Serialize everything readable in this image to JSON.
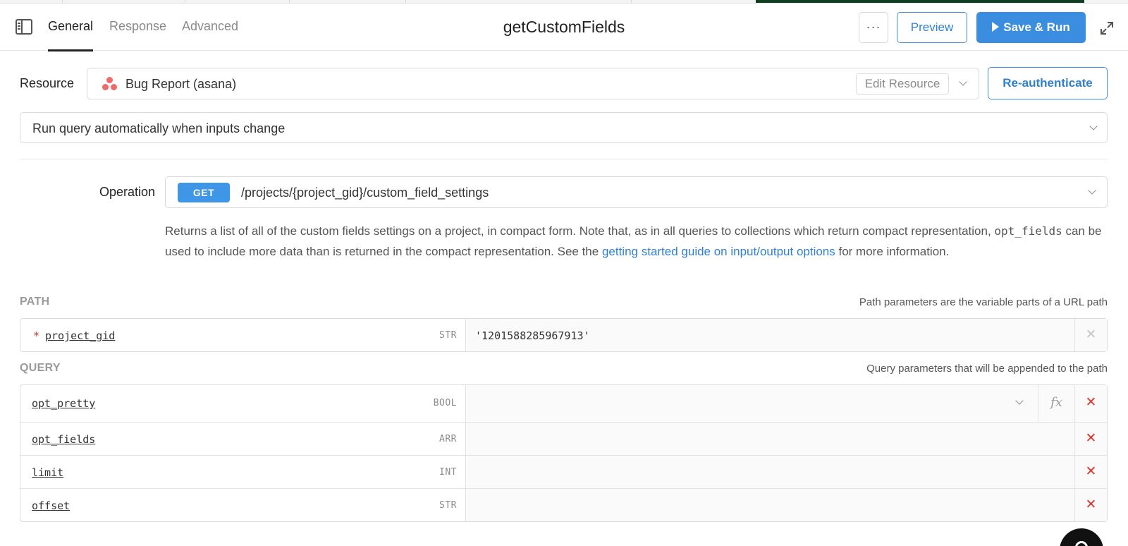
{
  "tabs": [
    {
      "label": "General"
    },
    {
      "label": "Response"
    },
    {
      "label": "Advanced"
    }
  ],
  "query_name": "getCustomFields",
  "header_actions": {
    "more_label": "···",
    "preview_label": "Preview",
    "save_run_label": "Save & Run"
  },
  "resource": {
    "label": "Resource",
    "name": "Bug Report (asana)",
    "edit_label": "Edit Resource",
    "reauth_label": "Re-authenticate"
  },
  "run_mode": {
    "value": "Run query automatically when inputs change"
  },
  "operation": {
    "label": "Operation",
    "method": "GET",
    "path": "/projects/{project_gid}/custom_field_settings",
    "description_part1": "Returns a list of all of the custom fields settings on a project, in compact form. Note that, as in all queries to collections which return compact representation,",
    "description_code": "opt_fields",
    "description_part2": "can be used to include more data than is returned in the compact representation. See the",
    "description_link": "getting started guide on input/output options",
    "description_part3": "for more information."
  },
  "path_section": {
    "title": "PATH",
    "hint": "Path parameters are the variable parts of a URL path",
    "params": [
      {
        "name": "project_gid",
        "required_mark": "*",
        "type": "STR",
        "value": "'1201588285967913'"
      }
    ]
  },
  "query_section": {
    "title": "QUERY",
    "hint": "Query parameters that will be appended to the path",
    "params": [
      {
        "name": "opt_pretty",
        "type": "BOOL",
        "value": ""
      },
      {
        "name": "opt_fields",
        "type": "ARR",
        "value": ""
      },
      {
        "name": "limit",
        "type": "INT",
        "value": ""
      },
      {
        "name": "offset",
        "type": "STR",
        "value": ""
      }
    ]
  },
  "glyphs": {
    "remove": "✕",
    "fx": "fx"
  },
  "colors": {
    "accent": "#3b8de0",
    "danger": "#d8392b",
    "asana": "#f06a6a"
  }
}
